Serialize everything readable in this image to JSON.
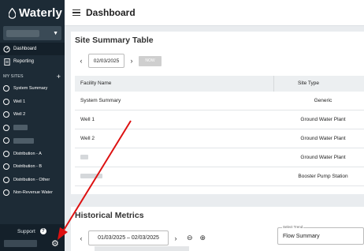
{
  "app": {
    "name": "Waterly",
    "brand_color": "#1d2b36",
    "accent": "#d11"
  },
  "sidebar": {
    "nav": [
      {
        "label": "Dashboard",
        "icon": "dashboard-gauge-icon",
        "active": true
      },
      {
        "label": "Reporting",
        "icon": "report-icon",
        "active": false
      }
    ],
    "section_label": "MY SITES",
    "sites": [
      {
        "label": "System Summary"
      },
      {
        "label": "Well 1"
      },
      {
        "label": "Well 2"
      },
      {
        "label": ""
      },
      {
        "label": ""
      },
      {
        "label": "Distribution - A"
      },
      {
        "label": "Distribution - B"
      },
      {
        "label": "Distribution - Other"
      },
      {
        "label": "Non-Revenue Water"
      }
    ],
    "support_label": "Support"
  },
  "header": {
    "title": "Dashboard"
  },
  "summary": {
    "title": "Site Summary Table",
    "date": "02/03/2025",
    "now_label": "NOW",
    "columns": [
      "Facility Name",
      "Site Type"
    ],
    "rows": [
      {
        "name": "System Summary",
        "type": "Generic"
      },
      {
        "name": "Well 1",
        "type": "Ground Water Plant"
      },
      {
        "name": "Well 2",
        "type": "Ground Water Plant"
      },
      {
        "name": "",
        "type": "Ground Water Plant"
      },
      {
        "name": "",
        "type": "Booster Pump Station"
      }
    ]
  },
  "metrics": {
    "title": "Historical Metrics",
    "range": "01/03/2025 – 02/03/2025",
    "trend_label": "Select Trend",
    "trend_value": "Flow Summary"
  }
}
